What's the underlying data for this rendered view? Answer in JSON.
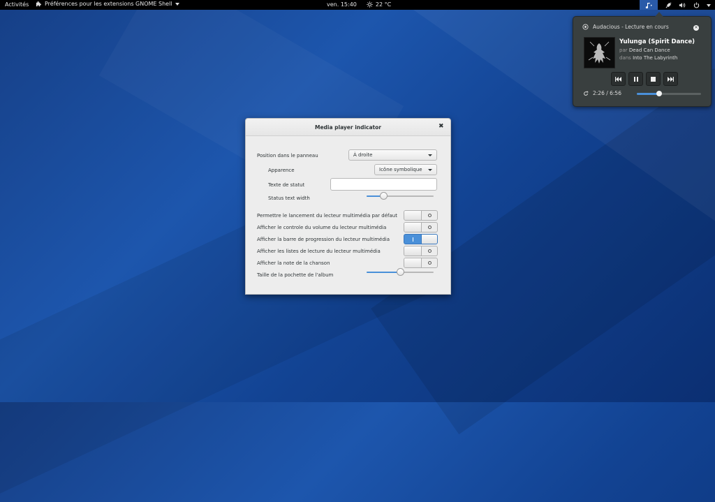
{
  "topbar": {
    "activities": "Activités",
    "app_menu": "Préférences pour les extensions GNOME Shell",
    "clock": "ven. 15:40",
    "weather": "22 °C"
  },
  "popup": {
    "header": "Audacious - Lecture en cours",
    "title": "Yulunga (Spirit Dance)",
    "artist_prefix": "par",
    "artist": "Dead Can Dance",
    "album_prefix": "dans",
    "album": "Into The Labyrinth",
    "time": "2:26 / 6:56",
    "progress_fraction": 0.35
  },
  "dialog": {
    "title": "Media player indicator",
    "position_label": "Position dans le panneau",
    "position_value": "À droite",
    "appearance_label": "Apparence",
    "appearance_value": "Icône symbolique",
    "status_text_label": "Texte de statut",
    "status_text_value": "",
    "status_width_label": "Status text width",
    "status_width_fraction": 0.25,
    "toggles": [
      {
        "label": "Permettre le lancement du lecteur multimédia par défaut",
        "on": false
      },
      {
        "label": "Afficher le controle du volume du lecteur multimédia",
        "on": false
      },
      {
        "label": "Afficher la barre de progression du lecteur multimédia",
        "on": true
      },
      {
        "label": "Afficher les listes de lecture du lecteur multimédia",
        "on": false
      },
      {
        "label": "Afficher la note de la chanson",
        "on": false
      }
    ],
    "cover_size_label": "Taille de la pochette de l'album",
    "cover_size_fraction": 0.5
  }
}
